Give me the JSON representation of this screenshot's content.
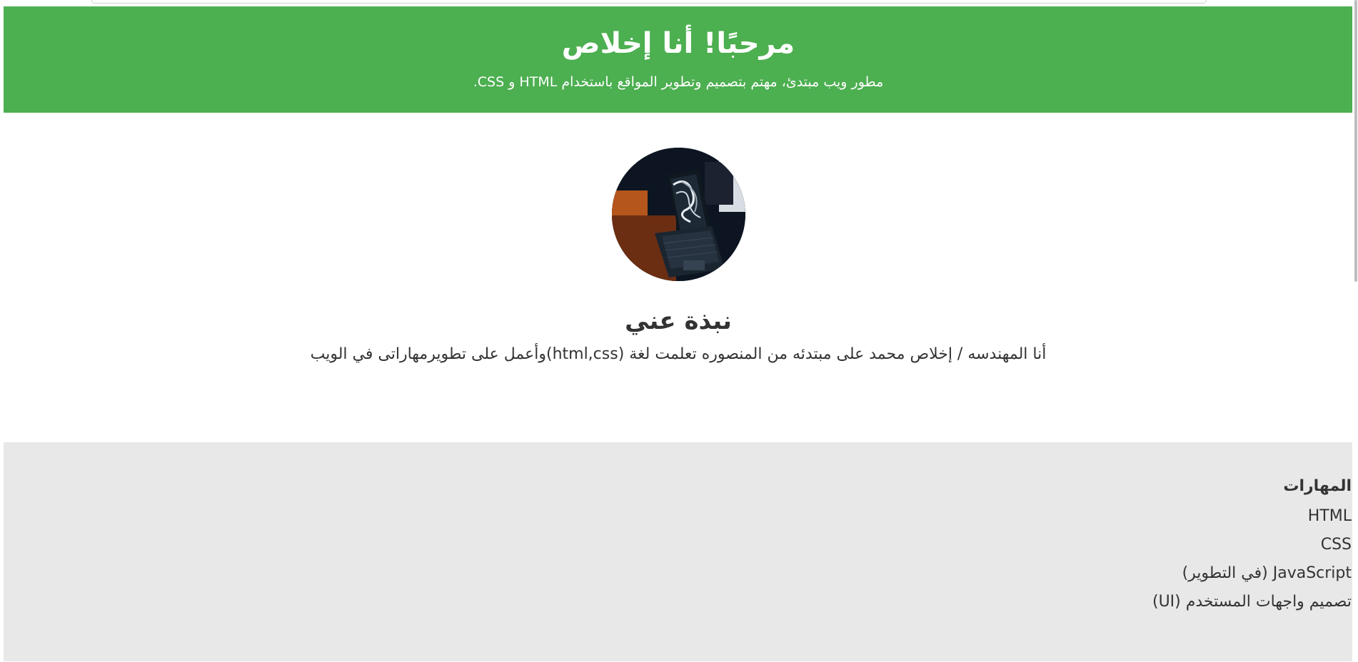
{
  "header": {
    "title": "مرحبًا! أنا إخلاص",
    "subtitle": "مطور ويب مبتدئ، مهتم بتصميم وتطوير المواقع باستخدام HTML و CSS."
  },
  "about": {
    "heading": "نبذة عني",
    "text": "أنا المهندسه / إخلاص محمد على مبتدئه من المنصوره تعلمت لغة (html,css)وأعمل على تطويرمهاراتى في الويب"
  },
  "skills": {
    "heading": "المهارات",
    "items": [
      "HTML",
      "CSS",
      "JavaScript (في التطوير)",
      "تصميم واجهات المستخدم (UI)"
    ]
  }
}
